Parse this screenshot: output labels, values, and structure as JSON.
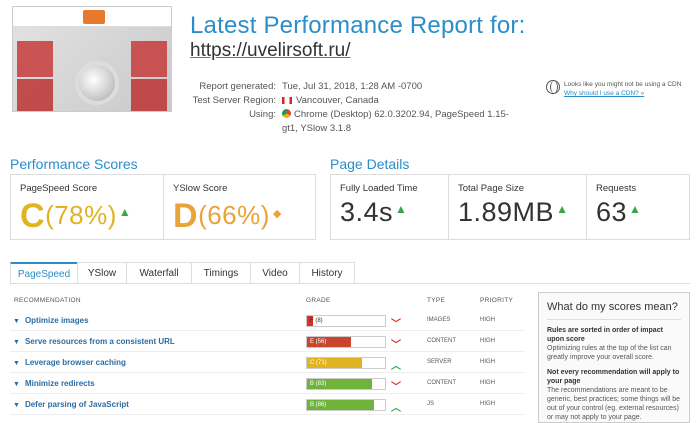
{
  "header": {
    "title": "Latest Performance Report for:",
    "url": "https://uvelirsoft.ru/",
    "meta": [
      {
        "key": "Report generated:",
        "value": "Tue, Jul 31, 2018, 1:28 AM -0700"
      },
      {
        "key": "Test Server Region:",
        "value": "Vancouver, Canada"
      },
      {
        "key": "Using:",
        "value": "Chrome (Desktop) 62.0.3202.94, PageSpeed 1.15-gt1, YSlow 3.1.8"
      }
    ],
    "cdn_note": "Looks like you might not be using a CDN",
    "cdn_link": "Why should I use a CDN? »"
  },
  "performance": {
    "title": "Performance Scores",
    "pagespeed": {
      "label": "PageSpeed Score",
      "grade": "C",
      "score": "(78%)"
    },
    "yslow": {
      "label": "YSlow Score",
      "grade": "D",
      "score": "(66%)"
    }
  },
  "details": {
    "title": "Page Details",
    "load_time": {
      "label": "Fully Loaded Time",
      "value": "3.4s"
    },
    "page_size": {
      "label": "Total Page Size",
      "value": "1.89MB"
    },
    "requests": {
      "label": "Requests",
      "value": "63"
    }
  },
  "tabs": [
    "PageSpeed",
    "YSlow",
    "Waterfall",
    "Timings",
    "Video",
    "History"
  ],
  "table": {
    "headers": {
      "recommendation": "RECOMMENDATION",
      "grade": "GRADE",
      "type": "TYPE",
      "priority": "PRIORITY"
    },
    "rows": [
      {
        "name": "Optimize images",
        "grade": "F (8)",
        "pct": 8,
        "color": "#d9302c",
        "trend": "down",
        "type": "IMAGES",
        "priority": "HIGH"
      },
      {
        "name": "Serve resources from a consistent URL",
        "grade": "E (56)",
        "pct": 56,
        "color": "#c9452b",
        "trend": "down",
        "type": "CONTENT",
        "priority": "HIGH"
      },
      {
        "name": "Leverage browser caching",
        "grade": "C (71)",
        "pct": 71,
        "color": "#e2b320",
        "trend": "up",
        "type": "SERVER",
        "priority": "HIGH"
      },
      {
        "name": "Minimize redirects",
        "grade": "B (83)",
        "pct": 83,
        "color": "#6fb33a",
        "trend": "down",
        "type": "CONTENT",
        "priority": "HIGH"
      },
      {
        "name": "Defer parsing of JavaScript",
        "grade": "B (86)",
        "pct": 86,
        "color": "#6fb33a",
        "trend": "up",
        "type": "JS",
        "priority": "HIGH"
      }
    ]
  },
  "sidebar": {
    "title": "What do my scores mean?",
    "p1_bold": "Rules are sorted in order of impact upon score",
    "p1_text": "Optimizing rules at the top of the list can greatly improve your overall score.",
    "p2_bold": "Not every recommendation will apply to your page",
    "p2_text": "The recommendations are meant to be generic, best practices; some things will be out of your control (eg. external resources) or may not apply to your page."
  },
  "colors": {
    "accent": "#2b8ec8",
    "grade_c": "#e2b320",
    "grade_d": "#e9a33a",
    "good": "#3aa64c",
    "bad": "#d9302c"
  }
}
